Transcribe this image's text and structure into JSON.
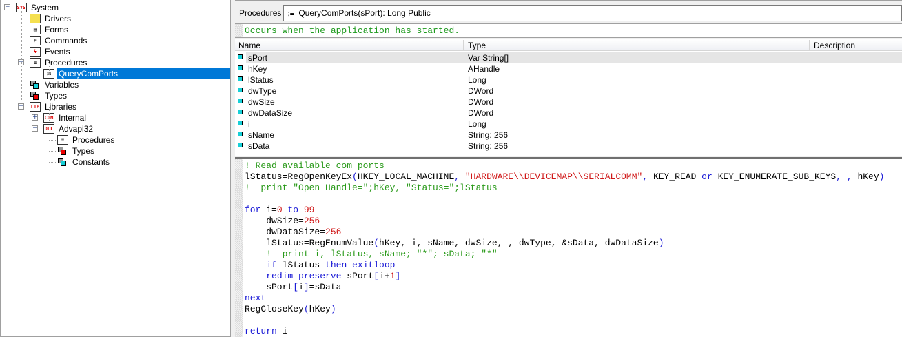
{
  "tree": [
    {
      "label": "System",
      "icon": "sys-icon",
      "depth": 0,
      "expander": "-"
    },
    {
      "label": "Drivers",
      "icon": "folder-icon",
      "depth": 1
    },
    {
      "label": "Forms",
      "icon": "forms-icon",
      "depth": 1
    },
    {
      "label": "Commands",
      "icon": "commands-icon",
      "depth": 1
    },
    {
      "label": "Events",
      "icon": "events-icon",
      "depth": 1
    },
    {
      "label": "Procedures",
      "icon": "procedures-icon",
      "depth": 1,
      "expander": "-"
    },
    {
      "label": "QueryComPorts",
      "icon": "procedure-icon",
      "depth": 2,
      "selected": true
    },
    {
      "label": "Variables",
      "icon": "variables-icon",
      "depth": 1
    },
    {
      "label": "Types",
      "icon": "types-icon",
      "depth": 1
    },
    {
      "label": "Libraries",
      "icon": "libraries-icon",
      "depth": 1,
      "expander": "-"
    },
    {
      "label": "Internal",
      "icon": "com-library-icon",
      "depth": 2,
      "expander": "+"
    },
    {
      "label": "Advapi32",
      "icon": "dll-library-icon",
      "depth": 2,
      "expander": "-"
    },
    {
      "label": "Procedures",
      "icon": "procedures-icon",
      "depth": 3
    },
    {
      "label": "Types",
      "icon": "types-icon",
      "depth": 3
    },
    {
      "label": "Constants",
      "icon": "constants-icon",
      "depth": 3
    }
  ],
  "procbar": {
    "label": "Procedures :",
    "value": "QueryComPorts(sPort): Long Public"
  },
  "description": "Occurs when the application has started.",
  "table": {
    "columns": [
      "Name",
      "Type",
      "Description"
    ],
    "rows": [
      {
        "name": "sPort",
        "type": "Var String[]"
      },
      {
        "name": "hKey",
        "type": "AHandle"
      },
      {
        "name": "lStatus",
        "type": "Long"
      },
      {
        "name": "dwType",
        "type": "DWord"
      },
      {
        "name": "dwSize",
        "type": "DWord"
      },
      {
        "name": "dwDataSize",
        "type": "DWord"
      },
      {
        "name": "i",
        "type": "Long"
      },
      {
        "name": "sName",
        "type": "String: 256"
      },
      {
        "name": "sData",
        "type": "String: 256"
      }
    ]
  },
  "code": [
    [
      [
        "! Read available com ports",
        "c"
      ]
    ],
    [
      [
        "lStatus=RegOpenKeyEx",
        "t"
      ],
      [
        "(",
        "p"
      ],
      [
        "HKEY_LOCAL_MACHINE",
        "t"
      ],
      [
        ", ",
        "p"
      ],
      [
        "\"HARDWARE\\\\DEVICEMAP\\\\SERIALCOMM\"",
        "s"
      ],
      [
        ", ",
        "p"
      ],
      [
        "KEY_READ ",
        "t"
      ],
      [
        "or",
        "k"
      ],
      [
        " KEY_ENUMERATE_SUB_KEYS",
        "t"
      ],
      [
        ", , ",
        "p"
      ],
      [
        "hKey",
        "t"
      ],
      [
        ")",
        "p"
      ]
    ],
    [
      [
        "!  print \"Open Handle=\";hKey, \"Status=\";lStatus",
        "c"
      ]
    ],
    [],
    [
      [
        "for",
        "k"
      ],
      [
        " i=",
        "t"
      ],
      [
        "0",
        "n"
      ],
      [
        " to ",
        "k"
      ],
      [
        "99",
        "n"
      ]
    ],
    [
      [
        "    dwSize=",
        "t"
      ],
      [
        "256",
        "n"
      ]
    ],
    [
      [
        "    dwDataSize=",
        "t"
      ],
      [
        "256",
        "n"
      ]
    ],
    [
      [
        "    lStatus=RegEnumValue",
        "t"
      ],
      [
        "(",
        "p"
      ],
      [
        "hKey, i, sName, dwSize, , dwType, &sData, dwDataSize",
        "t"
      ],
      [
        ")",
        "p"
      ]
    ],
    [
      [
        "    !  print i, lStatus, sName; \"*\"; sData; \"*\"",
        "c"
      ]
    ],
    [
      [
        "    ",
        "t"
      ],
      [
        "if",
        "k"
      ],
      [
        " lStatus ",
        "t"
      ],
      [
        "then exitloop",
        "k"
      ]
    ],
    [
      [
        "    ",
        "t"
      ],
      [
        "redim preserve",
        "k"
      ],
      [
        " sPort",
        "t"
      ],
      [
        "[",
        "p"
      ],
      [
        "i+",
        "t"
      ],
      [
        "1",
        "n"
      ],
      [
        "]",
        "p"
      ]
    ],
    [
      [
        "    sPort",
        "t"
      ],
      [
        "[",
        "p"
      ],
      [
        "i",
        "t"
      ],
      [
        "]",
        "p"
      ],
      [
        "=sData",
        "t"
      ]
    ],
    [
      [
        "next",
        "k"
      ]
    ],
    [
      [
        "RegCloseKey",
        "t"
      ],
      [
        "(",
        "p"
      ],
      [
        "hKey",
        "t"
      ],
      [
        ")",
        "p"
      ]
    ],
    [],
    [
      [
        "return",
        "k"
      ],
      [
        " i",
        "t"
      ]
    ]
  ],
  "colors": {
    "selection": "#0078d7",
    "comment": "#2a9a1a",
    "keyword": "#1a1ad6",
    "literal": "#d01818",
    "var_marker": "#16d0d8"
  }
}
